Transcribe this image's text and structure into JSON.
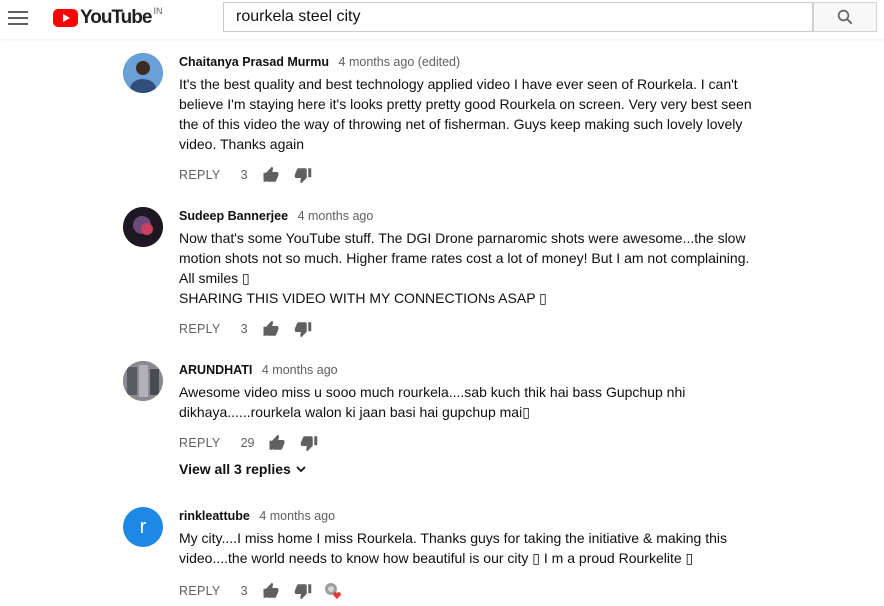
{
  "header": {
    "logo_text": "YouTube",
    "region": "IN",
    "search_value": "rourkela steel city"
  },
  "comments": [
    {
      "author": "Chaitanya Prasad Murmu",
      "time": "4 months ago (edited)",
      "text": "It's the best quality and best technology applied video I have ever seen of Rourkela. I can't\nbelieve I'm staying here it's looks pretty pretty good Rourkela on screen. Very very best seen\nthe of this video the way of throwing net of fisherman. Guys keep making such lovely lovely\nvideo. Thanks again",
      "reply_label": "REPLY",
      "likes": "3",
      "avatar_color": "#4a78b0"
    },
    {
      "author": "Sudeep Bannerjee",
      "time": "4 months ago",
      "text": "Now that's some YouTube stuff. The DGI Drone parnaromic shots were awesome...the slow\nmotion shots not so much. Higher frame rates cost a lot of money! But I am not complaining.\nAll smiles ▯\nSHARING THIS VIDEO WITH MY CONNECTIONs ASAP ▯",
      "reply_label": "REPLY",
      "likes": "3",
      "avatar_color": "#2a2230"
    },
    {
      "author": "ARUNDHATI",
      "time": "4 months ago",
      "text": "Awesome video miss u sooo much rourkela....sab kuch thik hai bass Gupchup nhi\ndikhaya......rourkela walon ki jaan basi hai gupchup mai▯",
      "reply_label": "REPLY",
      "likes": "29",
      "avatar_color": "#6b6b72",
      "view_replies": "View all 3 replies"
    },
    {
      "author": "rinkleattube",
      "time": "4 months ago",
      "text": "My city....I miss home I miss Rourkela. Thanks guys for taking the initiative & making this\nvideo....the world needs to know how beautiful is our city ▯ I m a proud Rourkelite ▯",
      "reply_label": "REPLY",
      "likes": "3",
      "avatar_letter": "r",
      "avatar_color": "#1e88e5"
    }
  ],
  "colors": {
    "brand_red": "#ff0000",
    "heart_red": "#e53935"
  }
}
